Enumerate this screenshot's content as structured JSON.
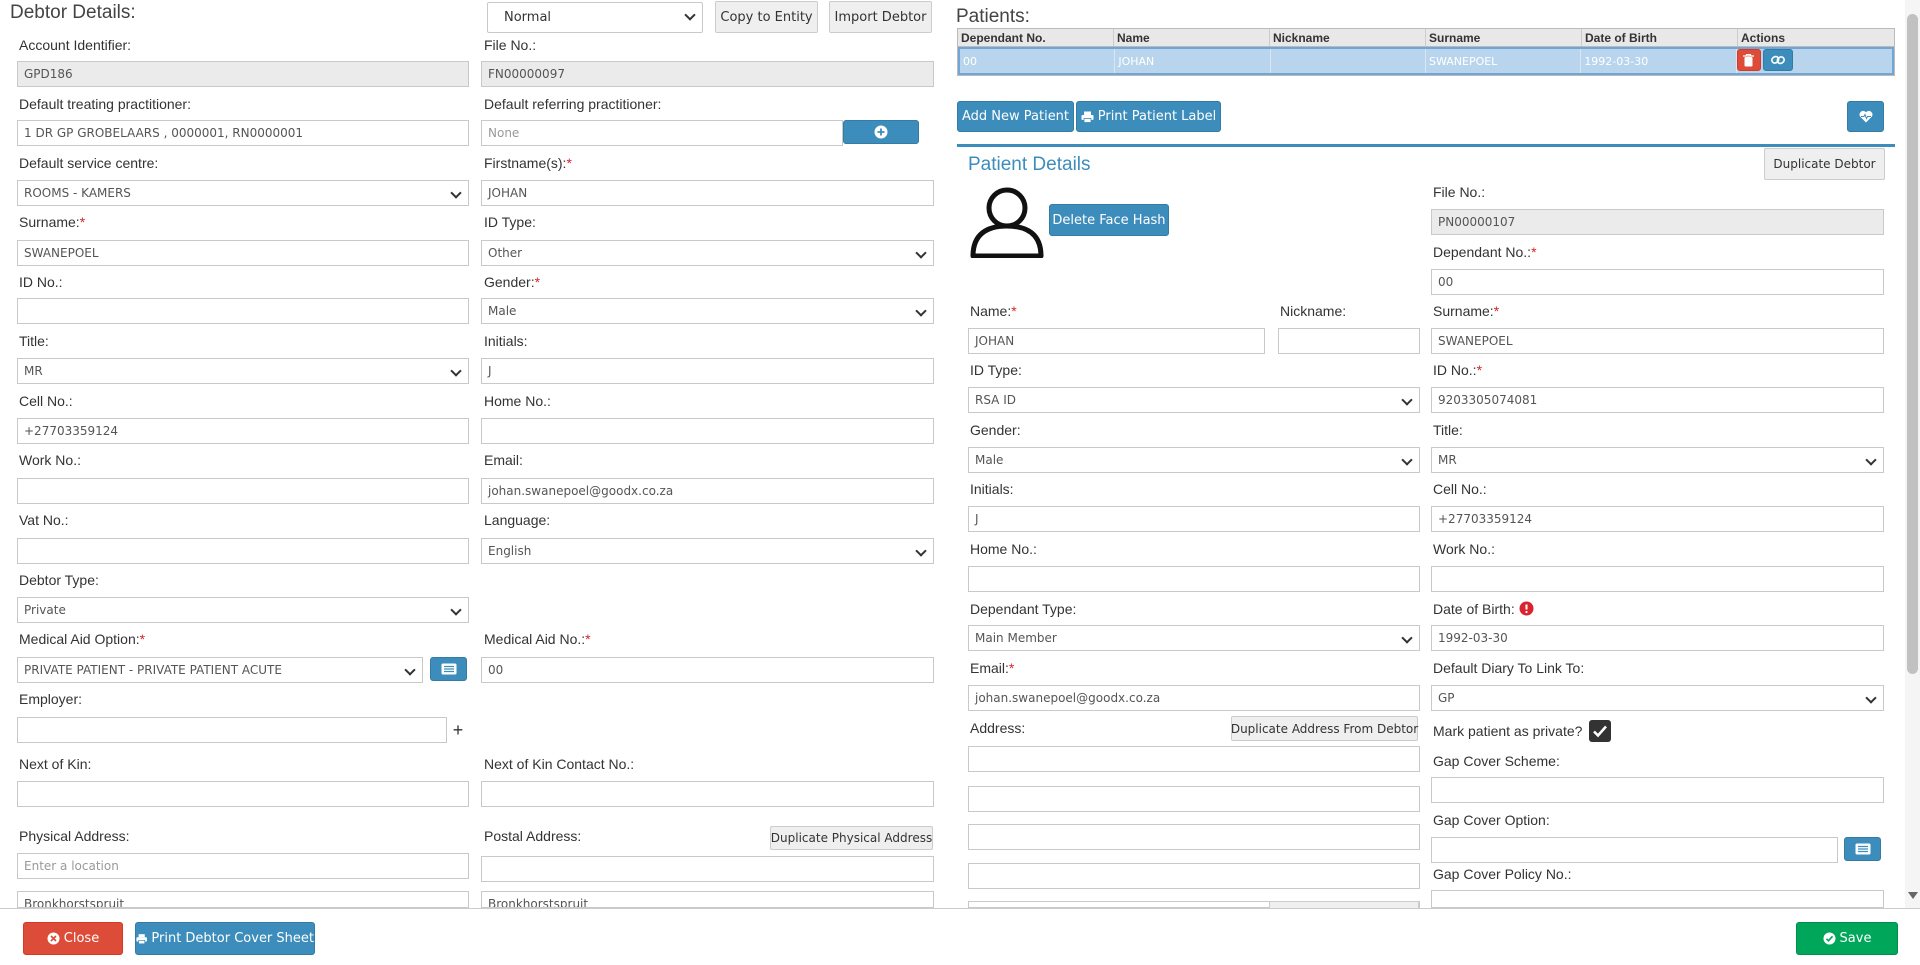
{
  "debtor": {
    "heading": "Debtor Details:",
    "mode_select": "Normal",
    "copy_to_entity": "Copy to Entity",
    "import_debtor": "Import Debtor",
    "account_identifier": {
      "label": "Account Identifier:",
      "value": "GPD186"
    },
    "file_no": {
      "label": "File No.:",
      "value": "FN00000097"
    },
    "default_treating_practitioner": {
      "label": "Default treating practitioner:",
      "value": "1 DR GP GROBELAARS , 0000001, RN0000001"
    },
    "default_referring_practitioner": {
      "label": "Default referring practitioner:",
      "placeholder": "None"
    },
    "default_service_centre": {
      "label": "Default service centre:",
      "value": "ROOMS - KAMERS"
    },
    "firstnames": {
      "label": "Firstname(s):",
      "value": "JOHAN"
    },
    "surname": {
      "label": "Surname:",
      "value": "SWANEPOEL"
    },
    "id_type": {
      "label": "ID Type:",
      "value": "Other"
    },
    "id_no": {
      "label": "ID No.:",
      "value": ""
    },
    "gender": {
      "label": "Gender:",
      "value": "Male"
    },
    "title": {
      "label": "Title:",
      "value": "MR"
    },
    "initials": {
      "label": "Initials:",
      "value": "J"
    },
    "cell_no": {
      "label": "Cell No.:",
      "value": "+27703359124"
    },
    "home_no": {
      "label": "Home No.:",
      "value": ""
    },
    "work_no": {
      "label": "Work No.:",
      "value": ""
    },
    "email": {
      "label": "Email:",
      "value": "johan.swanepoel@goodx.co.za"
    },
    "vat_no": {
      "label": "Vat No.:",
      "value": ""
    },
    "language": {
      "label": "Language:",
      "value": "English"
    },
    "debtor_type": {
      "label": "Debtor Type:",
      "value": "Private"
    },
    "medical_aid_option": {
      "label": "Medical Aid Option:",
      "value": "PRIVATE PATIENT - PRIVATE PATIENT ACUTE"
    },
    "medical_aid_no": {
      "label": "Medical Aid No.:",
      "value": "00"
    },
    "employer": {
      "label": "Employer:",
      "value": ""
    },
    "next_of_kin": {
      "label": "Next of Kin:",
      "value": ""
    },
    "next_of_kin_contact": {
      "label": "Next of Kin Contact No.:",
      "value": ""
    },
    "physical_address": {
      "label": "Physical Address:",
      "placeholder": "Enter a location",
      "line2": "Bronkhorstspruit"
    },
    "postal_address": {
      "label": "Postal Address:",
      "line2": "Bronkhorstspruit"
    },
    "duplicate_physical_address": "Duplicate Physical Address"
  },
  "patients": {
    "heading": "Patients:",
    "columns": [
      "Dependant No.",
      "Name",
      "Nickname",
      "Surname",
      "Date of Birth",
      "Actions"
    ],
    "rows": [
      {
        "dependant_no": "00",
        "name": "JOHAN",
        "nickname": "",
        "surname": "SWANEPOEL",
        "dob": "1992-03-30"
      }
    ],
    "add_new_patient": "Add New Patient",
    "print_patient_label": "Print Patient Label"
  },
  "patient": {
    "heading": "Patient Details",
    "duplicate_debtor": "Duplicate Debtor",
    "delete_face_hash": "Delete Face Hash",
    "file_no": {
      "label": "File No.:",
      "value": "PN00000107"
    },
    "dependant_no": {
      "label": "Dependant No.:",
      "value": "00"
    },
    "name": {
      "label": "Name:",
      "value": "JOHAN"
    },
    "nickname": {
      "label": "Nickname:",
      "value": ""
    },
    "surname": {
      "label": "Surname:",
      "value": "SWANEPOEL"
    },
    "id_type": {
      "label": "ID Type:",
      "value": "RSA ID"
    },
    "id_no": {
      "label": "ID No.:",
      "value": "9203305074081"
    },
    "gender": {
      "label": "Gender:",
      "value": "Male"
    },
    "title": {
      "label": "Title:",
      "value": "MR"
    },
    "initials": {
      "label": "Initials:",
      "value": "J"
    },
    "cell_no": {
      "label": "Cell No.:",
      "value": "+27703359124"
    },
    "home_no": {
      "label": "Home No.:",
      "value": ""
    },
    "work_no": {
      "label": "Work No.:",
      "value": ""
    },
    "dependant_type": {
      "label": "Dependant Type:",
      "value": "Main Member"
    },
    "date_of_birth": {
      "label": "Date of Birth:",
      "value": "1992-03-30"
    },
    "email": {
      "label": "Email:",
      "value": "johan.swanepoel@goodx.co.za"
    },
    "default_diary": {
      "label": "Default Diary To Link To:",
      "value": "GP"
    },
    "address": {
      "label": "Address:"
    },
    "duplicate_address": "Duplicate Address From Debtor",
    "mark_private": {
      "label": "Mark patient as private?",
      "checked": true
    },
    "gap_cover_scheme": {
      "label": "Gap Cover Scheme:",
      "value": ""
    },
    "gap_cover_option": {
      "label": "Gap Cover Option:",
      "value": ""
    },
    "gap_cover_policy": {
      "label": "Gap Cover Policy No.:",
      "value": ""
    }
  },
  "footer": {
    "close": "Close",
    "print_cover_sheet": "Print Debtor Cover Sheet",
    "save": "Save"
  },
  "colors": {
    "primary": "#3c8dbc",
    "danger": "#dd4b39",
    "success": "#00a65a",
    "required": "#d9232e"
  }
}
